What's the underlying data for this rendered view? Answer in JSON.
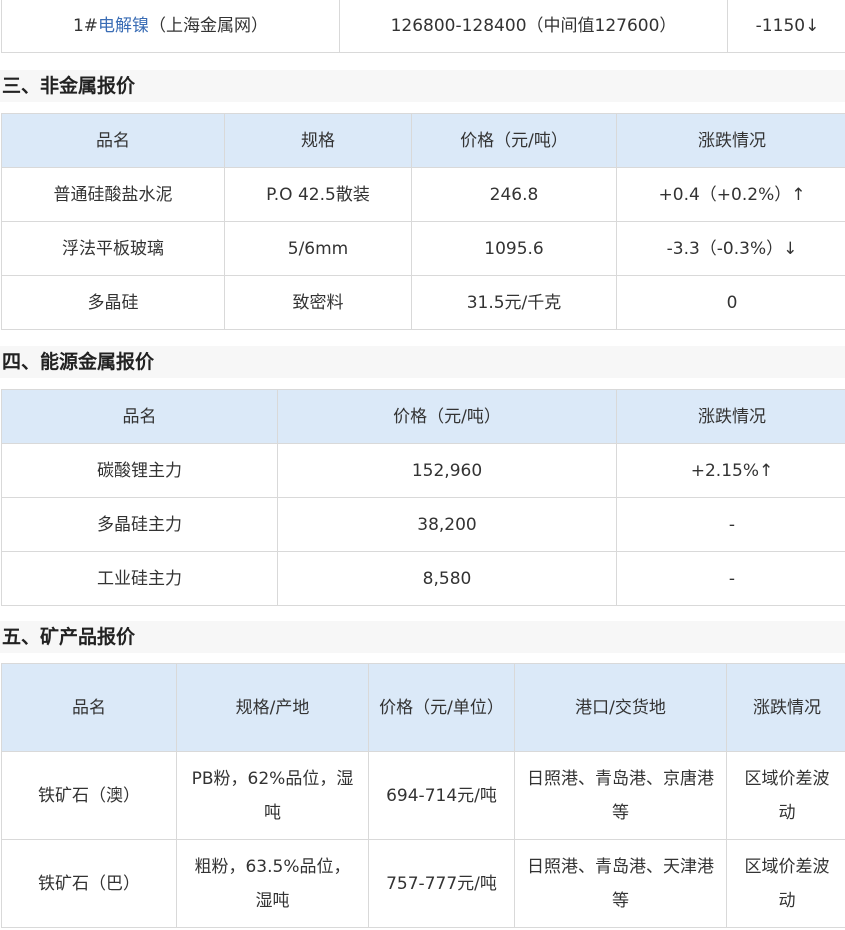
{
  "top_row": {
    "prefix": "1#",
    "name_link": "电解镍",
    "source": "（上海金属网）",
    "price": "126800-128400（中间值127600）",
    "change": "-1150↓"
  },
  "nonmetal": {
    "title": "三、非金属报价",
    "headers": [
      "品名",
      "规格",
      "价格（元/吨）",
      "涨跌情况"
    ],
    "rows": [
      [
        "普通硅酸盐水泥",
        "P.O 42.5散装",
        "246.8",
        "+0.4（+0.2%）↑"
      ],
      [
        "浮法平板玻璃",
        "5/6mm",
        "1095.6",
        "-3.3（-0.3%）↓"
      ],
      [
        "多晶硅",
        "致密料",
        "31.5元/千克",
        "0"
      ]
    ]
  },
  "energy": {
    "title": "四、能源金属报价",
    "headers": [
      "品名",
      "价格（元/吨）",
      "涨跌情况"
    ],
    "rows": [
      [
        "碳酸锂主力",
        "152,960",
        "+2.15%↑"
      ],
      [
        "多晶硅主力",
        "38,200",
        "-"
      ],
      [
        "工业硅主力",
        "8,580",
        "-"
      ]
    ]
  },
  "mineral": {
    "title": "五、矿产品报价",
    "headers": [
      "品名",
      "规格/产地",
      "价格（元/单位）",
      "港口/交货地",
      "涨跌情况"
    ],
    "rows": [
      [
        "铁矿石（澳）",
        "PB粉，62%品位，湿吨",
        "694-714元/吨",
        "日照港、青岛港、京唐港等",
        "区域价差波动"
      ],
      [
        "铁矿石（巴）",
        "粗粉，63.5%品位，湿吨",
        "757-777元/吨",
        "日照港、青岛港、天津港等",
        "区域价差波动"
      ]
    ]
  },
  "colors": {
    "header_bg": "#dbe9f8",
    "border": "#d9d9d9",
    "link": "#3a6db5",
    "section_bg": "#f7f7f7"
  }
}
